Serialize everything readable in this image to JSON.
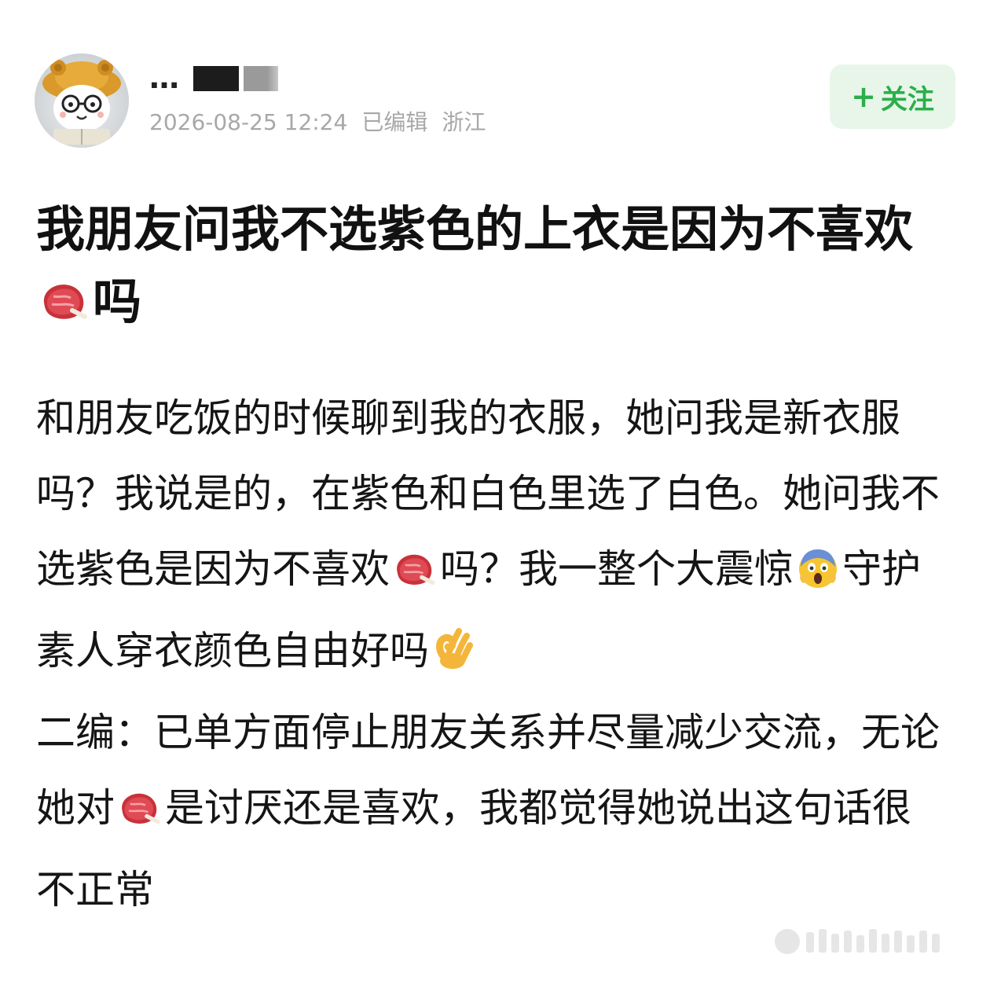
{
  "author": {
    "name_partial": "…",
    "timestamp": "2026-08-25 12:24",
    "edited_label": "已编辑",
    "location": "浙江"
  },
  "follow_button": {
    "plus": "+",
    "label": "关注"
  },
  "post": {
    "title_part1": "我朋友问我不选紫色的上衣是因为不喜欢",
    "title_part2": "吗",
    "body_part1": "和朋友吃饭的时候聊到我的衣服，她问我是新衣服吗？我说是的，在紫色和白色里选了白色。她问我不选紫色是因为不喜欢",
    "body_part2": "吗？我一整个大震惊",
    "body_part3": "守护素人穿衣颜色自由好吗",
    "edit_part1": "二编：已单方面停止朋友关系并尽量减少交流，无论她对",
    "edit_part2": "是讨厌还是喜欢，我都觉得她说出这句话很不正常"
  },
  "icons": {
    "meat": "meat-steak-icon",
    "scream": "face-screaming-icon",
    "ok": "ok-hand-icon"
  },
  "colors": {
    "follow_bg": "#e8f6ea",
    "follow_text": "#2cae4a",
    "meta_text": "#a8a8a8"
  }
}
